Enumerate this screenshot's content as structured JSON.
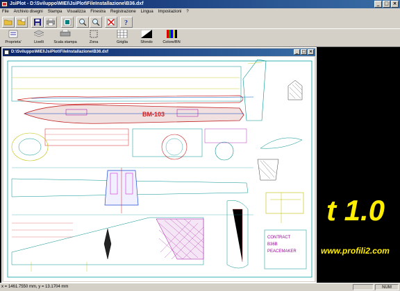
{
  "app": {
    "title": "JsiPlot - D:\\Sviluppo\\MIEI\\JsiPlot\\FileInstallazione\\B36.dxf",
    "window_buttons": [
      "_",
      "□",
      "×"
    ]
  },
  "menu": [
    "File",
    "Archivio disegni",
    "Stampa",
    "Visualizza",
    "Finestra",
    "Registrazione",
    "Lingua",
    "Impostazioni",
    "?"
  ],
  "toolbar1": [
    {
      "icon": "open-folder-icon"
    },
    {
      "icon": "open-file-icon"
    },
    {
      "icon": "save-icon"
    },
    {
      "icon": "print-icon"
    },
    {
      "icon": "preview-icon"
    },
    {
      "icon": "zoom-icon"
    },
    {
      "icon": "zoom-icon"
    },
    {
      "icon": "close-document-icon"
    },
    {
      "icon": "help-icon"
    }
  ],
  "toolbar2": [
    {
      "label": "Proprieta'",
      "icon": "properties-icon"
    },
    {
      "label": "Livelli",
      "icon": "layers-icon"
    },
    {
      "label": "Scala stampa",
      "icon": "print-scale-icon"
    },
    {
      "label": "Zona",
      "icon": "zone-icon"
    },
    {
      "label": "Griglia",
      "icon": "grid-icon"
    },
    {
      "label": "Sfondo",
      "icon": "background-icon"
    },
    {
      "label": "Colore/BN",
      "icon": "color-bw-icon"
    }
  ],
  "document": {
    "title": "D:\\Sviluppo\\MIEI\\JsiPlot\\FileInstallazione\\B36.dxf",
    "fuselage_code": "BM-103",
    "title_block": [
      "CONTRACT",
      "B36B",
      "PEACEMAKER"
    ]
  },
  "background": {
    "version_text": "t 1.0",
    "url_text": "www.profili2.com"
  },
  "status": {
    "coords": "x = 1461.7550 mm, y = 13.1704 mm",
    "num": "NUM"
  },
  "colors": {
    "title_bar": "#0a246a",
    "chrome": "#d4d0c8",
    "banner": "#ffee00",
    "drawing_outline": "#00a0a0"
  }
}
